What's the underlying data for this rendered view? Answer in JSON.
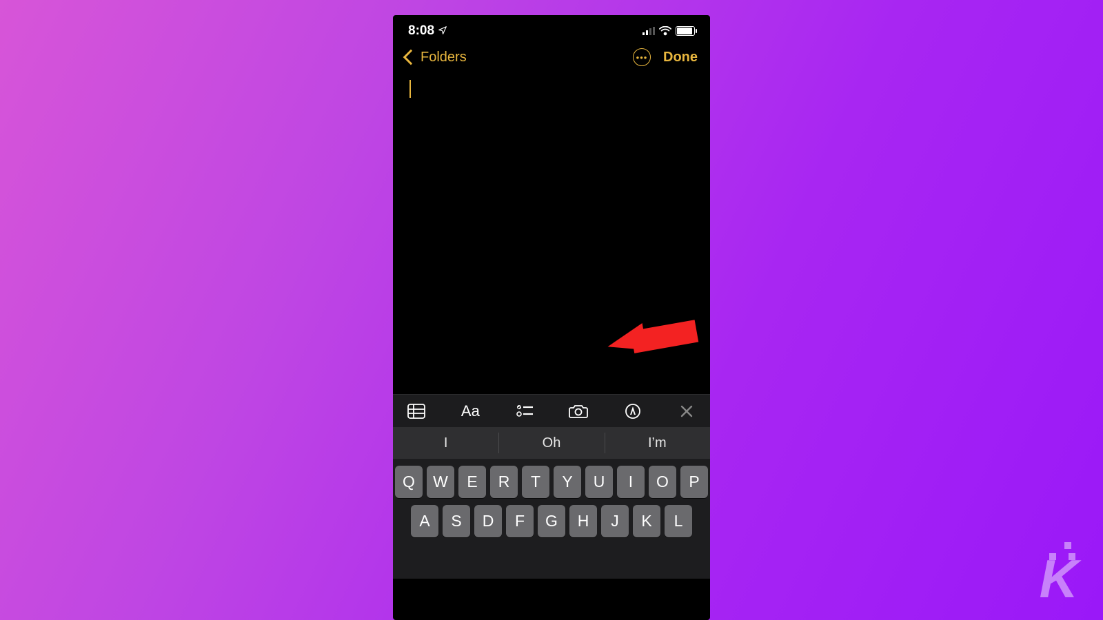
{
  "status": {
    "time": "8:08",
    "location_arrow": true
  },
  "nav": {
    "back_label": "Folders",
    "done_label": "Done"
  },
  "toolbar": {
    "items": [
      "table-icon",
      "text-format-icon",
      "checklist-icon",
      "camera-icon",
      "markup-icon",
      "close-icon"
    ],
    "aa_label": "Aa"
  },
  "suggestions": [
    "I",
    "Oh",
    "I’m"
  ],
  "keyboard": {
    "row1": [
      "Q",
      "W",
      "E",
      "R",
      "T",
      "Y",
      "U",
      "I",
      "O",
      "P"
    ],
    "row2": [
      "A",
      "S",
      "D",
      "F",
      "G",
      "H",
      "J",
      "K",
      "L"
    ]
  },
  "annotation": {
    "arrow_target": "markup-icon"
  },
  "branding": {
    "logo_letter": "K"
  }
}
